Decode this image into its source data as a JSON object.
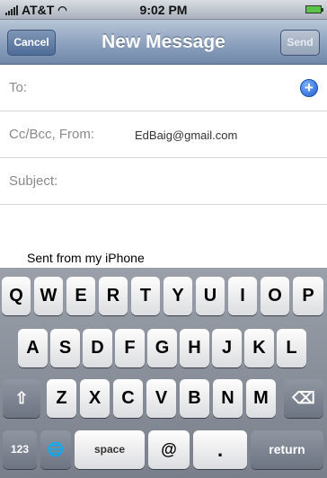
{
  "status": {
    "carrier": "AT&T",
    "time": "9:02 PM"
  },
  "nav": {
    "cancel": "Cancel",
    "title": "New Message",
    "send": "Send"
  },
  "form": {
    "to_label": "To:",
    "add_label": "+",
    "cc_label": "Cc/Bcc, From:",
    "from_value": "EdBaig@gmail.com",
    "subject_label": "Subject:",
    "body": "Sent from my iPhone"
  },
  "keyboard": {
    "row1": [
      "Q",
      "W",
      "E",
      "R",
      "T",
      "Y",
      "U",
      "I",
      "O",
      "P"
    ],
    "row2": [
      "A",
      "S",
      "D",
      "F",
      "G",
      "H",
      "J",
      "K",
      "L"
    ],
    "row3": [
      "Z",
      "X",
      "C",
      "V",
      "B",
      "N",
      "M"
    ],
    "shift": "⇧",
    "delete": "⌫",
    "num": "123",
    "globe": "🌐",
    "space": "space",
    "at": "@",
    "dot": ".",
    "return": "return"
  }
}
